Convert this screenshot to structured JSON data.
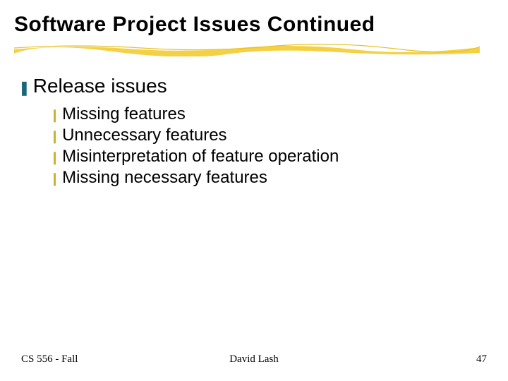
{
  "title": "Software Project Issues Continued",
  "level1": {
    "bullet": "❚",
    "text": "Release issues"
  },
  "level2": {
    "bullet": "❙",
    "items": [
      "Missing features",
      "Unnecessary features",
      "Misinterpretation of feature operation",
      "Missing necessary features"
    ]
  },
  "footer": {
    "left": "CS 556 - Fall",
    "center": "David Lash",
    "right": "47"
  },
  "colors": {
    "level1_bullet": "#18677a",
    "level2_bullet": "#c7b236",
    "underline": "#f3cf3a"
  }
}
